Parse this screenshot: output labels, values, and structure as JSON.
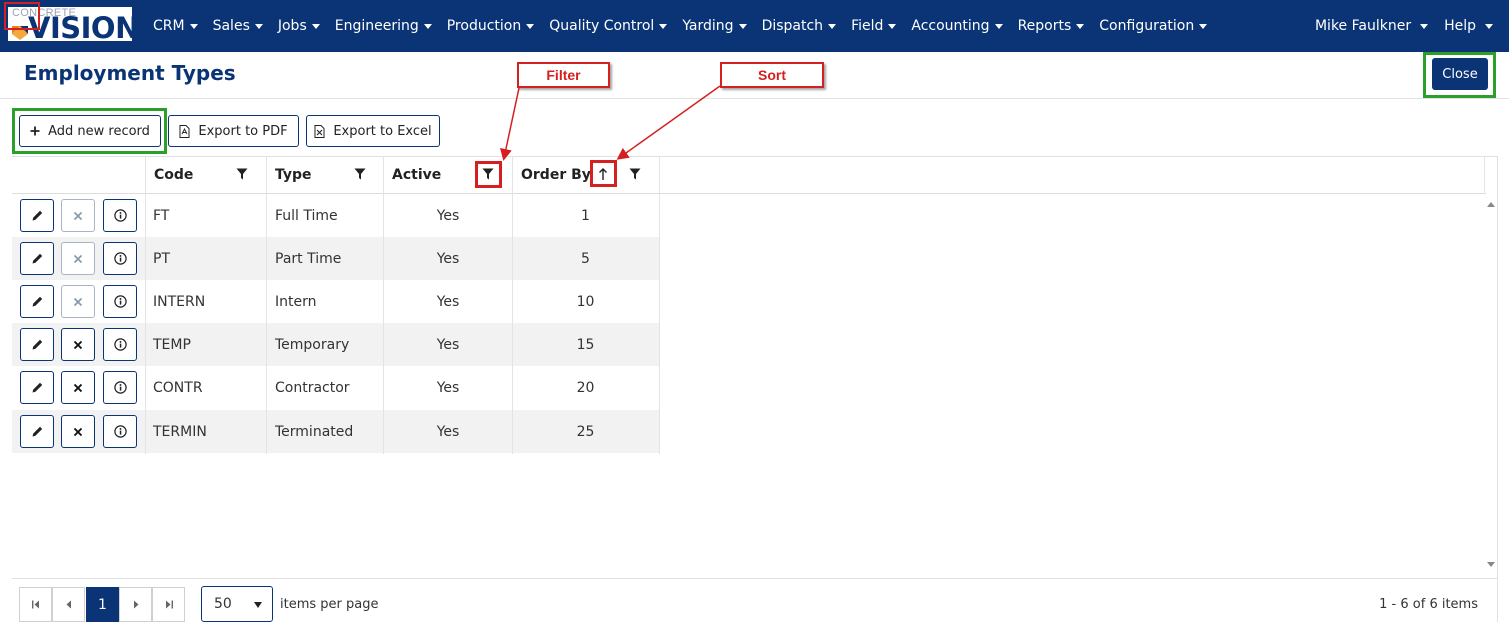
{
  "brand": {
    "top_text": "CONCRETE",
    "main_text": "VISION"
  },
  "nav": {
    "items": [
      {
        "label": "CRM"
      },
      {
        "label": "Sales"
      },
      {
        "label": "Jobs"
      },
      {
        "label": "Engineering"
      },
      {
        "label": "Production"
      },
      {
        "label": "Quality Control"
      },
      {
        "label": "Yarding"
      },
      {
        "label": "Dispatch"
      },
      {
        "label": "Field"
      },
      {
        "label": "Accounting"
      },
      {
        "label": "Reports"
      },
      {
        "label": "Configuration"
      }
    ],
    "user": "Mike Faulkner",
    "help": "Help"
  },
  "page": {
    "title": "Employment Types",
    "close_label": "Close"
  },
  "annotations": {
    "filter": "Filter",
    "sort": "Sort"
  },
  "toolbar": {
    "add_label": "Add new record",
    "pdf_label": "Export to PDF",
    "excel_label": "Export to Excel"
  },
  "grid": {
    "columns": {
      "code": "Code",
      "type": "Type",
      "active": "Active",
      "order_by": "Order By"
    },
    "rows": [
      {
        "code": "FT",
        "type": "Full Time",
        "active": "Yes",
        "order_by": "1",
        "delete_enabled": false
      },
      {
        "code": "PT",
        "type": "Part Time",
        "active": "Yes",
        "order_by": "5",
        "delete_enabled": false
      },
      {
        "code": "INTERN",
        "type": "Intern",
        "active": "Yes",
        "order_by": "10",
        "delete_enabled": false
      },
      {
        "code": "TEMP",
        "type": "Temporary",
        "active": "Yes",
        "order_by": "15",
        "delete_enabled": true
      },
      {
        "code": "CONTR",
        "type": "Contractor",
        "active": "Yes",
        "order_by": "20",
        "delete_enabled": true
      },
      {
        "code": "TERMIN",
        "type": "Terminated",
        "active": "Yes",
        "order_by": "25",
        "delete_enabled": true
      }
    ]
  },
  "pager": {
    "current_page": "1",
    "page_size": "50",
    "items_per_page_label": "items per page",
    "info": "1 - 6 of 6 items"
  },
  "colors": {
    "primary": "#0a3475",
    "annotation_red": "#d42020",
    "highlight_green": "#2aa02a"
  }
}
